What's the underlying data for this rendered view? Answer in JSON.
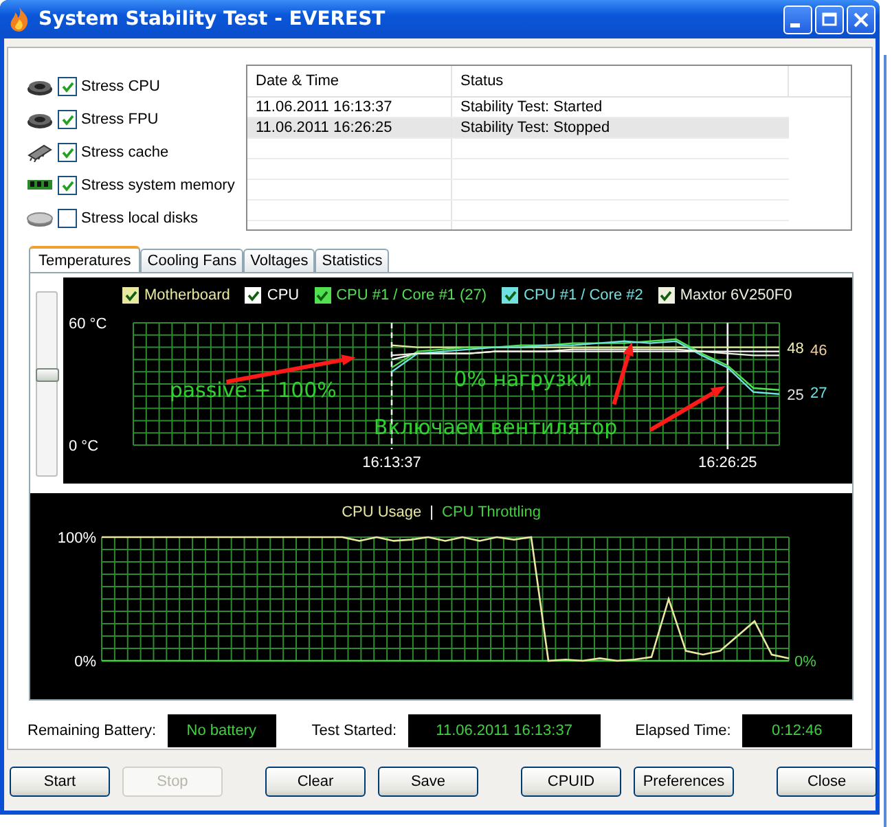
{
  "window": {
    "title": "System Stability Test - EVEREST"
  },
  "stress_options": [
    {
      "label": "Stress CPU",
      "checked": true
    },
    {
      "label": "Stress FPU",
      "checked": true
    },
    {
      "label": "Stress cache",
      "checked": true
    },
    {
      "label": "Stress system memory",
      "checked": true
    },
    {
      "label": "Stress local disks",
      "checked": false
    }
  ],
  "log": {
    "columns": [
      "Date & Time",
      "Status"
    ],
    "rows": [
      {
        "cells": [
          "11.06.2011 16:13:37",
          "Stability Test: Started"
        ],
        "selected": false
      },
      {
        "cells": [
          "11.06.2011 16:26:25",
          "Stability Test: Stopped"
        ],
        "selected": true
      }
    ]
  },
  "tabs": [
    {
      "label": "Temperatures",
      "selected": true
    },
    {
      "label": "Cooling Fans",
      "selected": false
    },
    {
      "label": "Voltages",
      "selected": false
    },
    {
      "label": "Statistics",
      "selected": false
    }
  ],
  "temperature_panel": {
    "slider": {
      "level": 0.55
    },
    "legend": [
      {
        "checked": true
      },
      {
        "checked": true
      },
      {
        "checked": true
      },
      {
        "checked": true
      },
      {
        "checked": true
      }
    ],
    "chart_data": {
      "type": "line",
      "grid": true,
      "legend": true,
      "categories": [
        null,
        null,
        null,
        null,
        null,
        null,
        null,
        null,
        null,
        null,
        "16:13:37",
        null,
        null,
        null,
        null,
        null,
        null,
        null,
        null,
        null,
        null,
        null,
        null,
        "16:26:25",
        null,
        null
      ],
      "ylim": [
        0,
        60
      ],
      "yticks": [
        {
          "value": 0,
          "label": "0 °C"
        },
        {
          "value": 60,
          "label": "60 °C"
        }
      ],
      "series": [
        {
          "name": "Motherboard",
          "color": "#e8e8a0",
          "values": [
            null,
            null,
            null,
            null,
            null,
            null,
            null,
            null,
            null,
            null,
            49,
            48,
            48,
            48,
            48,
            48,
            48,
            48,
            48,
            48,
            48,
            48,
            48,
            48,
            48,
            48
          ]
        },
        {
          "name": "CPU",
          "color": "#ffffff",
          "values": [
            null,
            null,
            null,
            null,
            null,
            null,
            null,
            null,
            null,
            null,
            42,
            45,
            45,
            45,
            46,
            46,
            46,
            46,
            46,
            46,
            46,
            46,
            46,
            46,
            46,
            46
          ]
        },
        {
          "name": "CPU #1 / Core #1 (27)",
          "color": "#50e050",
          "values": [
            null,
            null,
            null,
            null,
            null,
            null,
            null,
            null,
            null,
            null,
            38,
            46,
            47,
            48,
            48,
            49,
            49,
            50,
            50,
            50,
            51,
            52,
            45,
            39,
            28,
            27
          ]
        },
        {
          "name": "CPU #1 / Core #2",
          "color": "#70e0e0",
          "values": [
            null,
            null,
            null,
            null,
            null,
            null,
            null,
            null,
            null,
            null,
            36,
            45,
            46,
            47,
            48,
            48,
            49,
            49,
            50,
            51,
            50,
            51,
            44,
            38,
            26,
            25
          ]
        },
        {
          "name": "Maxtor 6V250F0",
          "color": "#f0f0e0",
          "values": [
            null,
            null,
            null,
            null,
            null,
            null,
            null,
            null,
            null,
            null,
            44,
            45,
            45,
            45,
            46,
            46,
            46,
            47,
            47,
            47,
            47,
            47,
            46,
            45,
            44,
            44
          ]
        }
      ]
    },
    "current_values": [
      {
        "text": "48",
        "color": "#f0f0b0"
      },
      {
        "text": "46",
        "color": "#f0d0a0"
      },
      {
        "text": "25",
        "color": "#e0e0e0"
      },
      {
        "text": "27",
        "color": "#70e0e0"
      }
    ],
    "notes": [
      "passive + 100%",
      "0% нагрузки",
      "Включаем вентилятор"
    ]
  },
  "cpu_panel": {
    "separator": "|",
    "current_value": "0%",
    "chart_data": {
      "type": "line",
      "grid": true,
      "categories": [
        null,
        null,
        null,
        null,
        null,
        null,
        null,
        null,
        null,
        null,
        null,
        null,
        null,
        null,
        null,
        null,
        null,
        null,
        null,
        null,
        null,
        null,
        null,
        null,
        null,
        null,
        null,
        null,
        null,
        null,
        null,
        null,
        null,
        null,
        null,
        null,
        null,
        null,
        null,
        null,
        null
      ],
      "ylim": [
        0,
        100
      ],
      "yticks": [
        {
          "value": 0,
          "label": "0%"
        },
        {
          "value": 100,
          "label": "100%"
        }
      ],
      "series": [
        {
          "name": "CPU Usage",
          "color": "#e8e8a0",
          "values": [
            100,
            100,
            100,
            100,
            100,
            100,
            100,
            100,
            100,
            100,
            100,
            100,
            100,
            100,
            100,
            97,
            100,
            97,
            98,
            100,
            97,
            100,
            97,
            100,
            98,
            100,
            0,
            1,
            0,
            2,
            0,
            1,
            3,
            50,
            8,
            5,
            8,
            20,
            32,
            5,
            2
          ]
        },
        {
          "name": "CPU Throttling",
          "color": "#40d040",
          "values": [
            0,
            0,
            0,
            0,
            0,
            0,
            0,
            0,
            0,
            0,
            0,
            0,
            0,
            0,
            0,
            0,
            0,
            0,
            0,
            0,
            0,
            0,
            0,
            0,
            0,
            0,
            0,
            0,
            0,
            0,
            0,
            0,
            0,
            0,
            0,
            0,
            0,
            0,
            0,
            0,
            0
          ]
        }
      ]
    }
  },
  "info": [
    {
      "label": "Remaining Battery:",
      "value": "No battery"
    },
    {
      "label": "Test Started:",
      "value": "11.06.2011 16:13:37"
    },
    {
      "label": "Elapsed Time:",
      "value": "0:12:46"
    }
  ],
  "button_groups": [
    [
      {
        "label": "Start",
        "disabled": false
      },
      {
        "label": "Stop",
        "disabled": true
      }
    ],
    [
      {
        "label": "Clear",
        "disabled": false
      },
      {
        "label": "Save",
        "disabled": false
      }
    ],
    [
      {
        "label": "CPUID",
        "disabled": false
      },
      {
        "label": "Preferences",
        "disabled": false
      }
    ],
    [
      {
        "label": "Close",
        "disabled": false
      }
    ]
  ]
}
